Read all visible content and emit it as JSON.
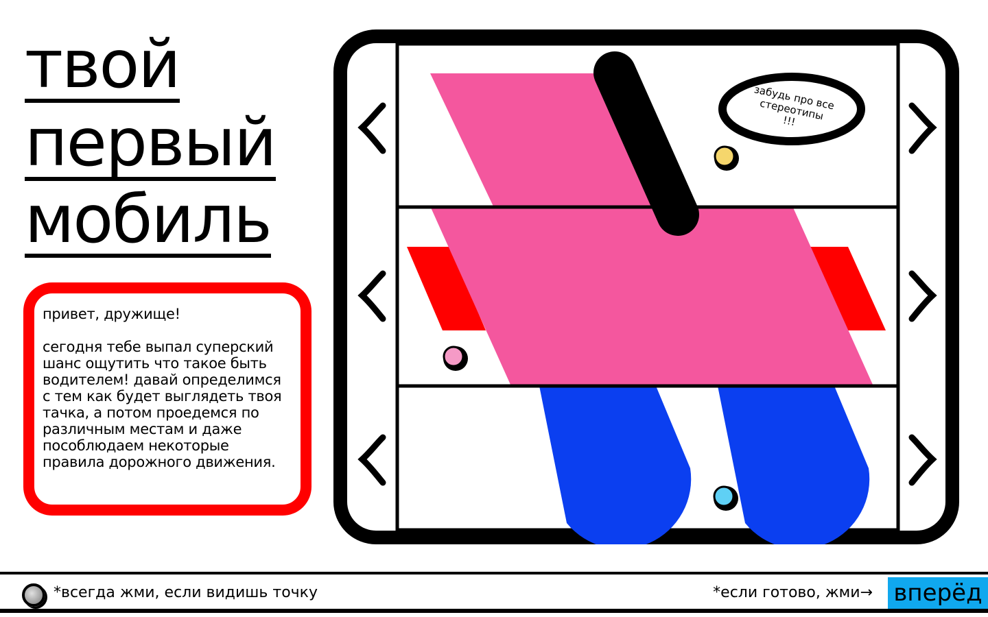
{
  "title": {
    "line1": "твой",
    "line2": "первый",
    "line3": "мобиль"
  },
  "intro": {
    "greeting": "привет, дружище!",
    "body": "сегодня тебе выпал суперский шанс ощутить что такое быть водителем! давай определимся с тем как будет выглядеть твоя тачка, а потом проедемся по различным местам и даже пособлюдаем некоторые правила дорожного движения."
  },
  "bubble": {
    "line1": "забудь про все",
    "line2": "стереотипы",
    "line3": "!!!"
  },
  "arrows": {
    "left": "‹",
    "right": "›"
  },
  "colors": {
    "pink": "#f4579e",
    "red": "#ff0000",
    "blue": "#0b3ff0",
    "yellow_dot": "#f5d66c",
    "pink_dot": "#f59ac6",
    "cyan_dot": "#5fd0f5",
    "button": "#10a8ee"
  },
  "footer": {
    "hint_left": "*всегда жми, если видишь точку",
    "hint_right": "*если готово, жми→",
    "next_label": "вперёд"
  }
}
